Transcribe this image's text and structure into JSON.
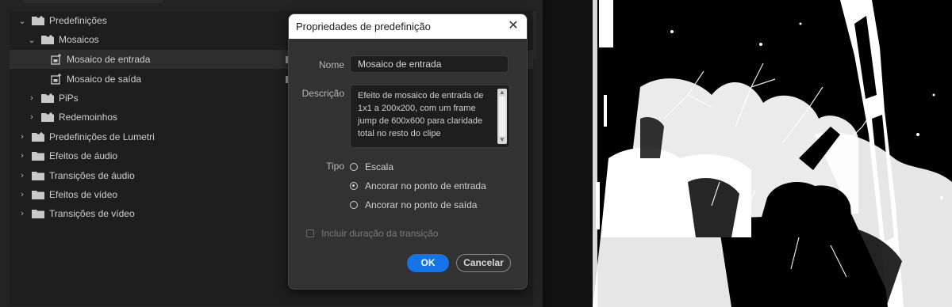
{
  "effects_tree": {
    "items": [
      {
        "label": "Predefinições",
        "expanded": true,
        "icon": "special-folder-icon"
      },
      {
        "label": "Mosaicos",
        "expanded": true,
        "icon": "special-folder-icon"
      },
      {
        "label": "Mosaico de entrada",
        "icon": "preset-icon",
        "selected": true
      },
      {
        "label": "Mosaico de saída",
        "icon": "preset-icon"
      },
      {
        "label": "PiPs",
        "expanded": false,
        "icon": "special-folder-icon"
      },
      {
        "label": "Redemoinhos",
        "expanded": false,
        "icon": "special-folder-icon"
      },
      {
        "label": "Predefinições de Lumetri",
        "expanded": false,
        "icon": "special-folder-icon"
      },
      {
        "label": "Efeitos de áudio",
        "expanded": false,
        "icon": "folder-icon"
      },
      {
        "label": "Transições de áudio",
        "expanded": false,
        "icon": "folder-icon"
      },
      {
        "label": "Efeitos de vídeo",
        "expanded": false,
        "icon": "folder-icon"
      },
      {
        "label": "Transições de vídeo",
        "expanded": false,
        "icon": "folder-icon"
      }
    ]
  },
  "dialog": {
    "title": "Propriedades de predefinição",
    "name_label": "Nome",
    "name_value": "Mosaico de entrada",
    "description_label": "Descrição",
    "description_value": "Efeito de mosaico de entrada de 1x1 a 200x200, com um frame jump de 600x600 para claridade total no resto do clipe",
    "type_label": "Tipo",
    "type_options": [
      {
        "label": "Escala",
        "selected": false
      },
      {
        "label": "Ancorar no ponto de entrada",
        "selected": true
      },
      {
        "label": "Ancorar no ponto de saída",
        "selected": false
      }
    ],
    "include_duration_label": "Incluir duração da transição",
    "include_duration_checked": false,
    "ok_label": "OK",
    "cancel_label": "Cancelar"
  },
  "colors": {
    "accent": "#1473e6",
    "panel_bg": "#232323",
    "dialog_bg": "#323232"
  }
}
